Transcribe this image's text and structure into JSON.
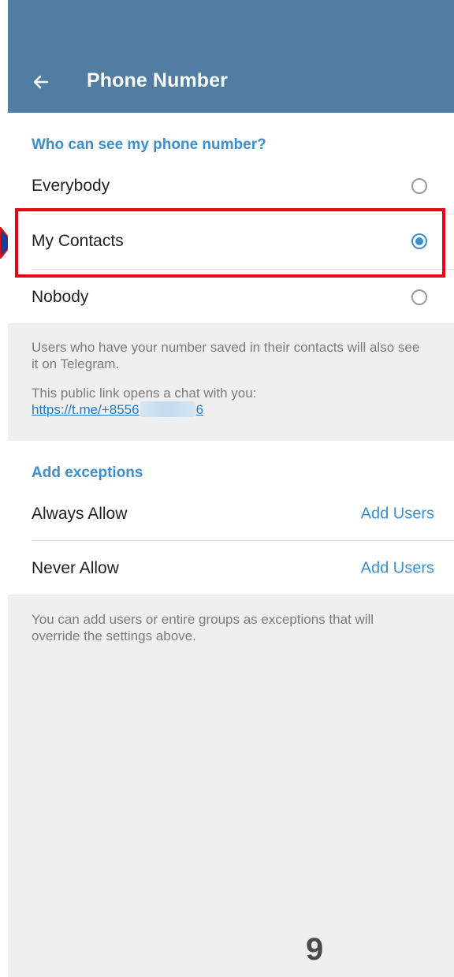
{
  "appbar": {
    "title": "Phone Number",
    "back_icon": "arrow-left-icon",
    "color": "#517da2"
  },
  "privacy": {
    "header": "Who can see my phone number?",
    "options": [
      {
        "label": "Everybody",
        "selected": false
      },
      {
        "label": "My Contacts",
        "selected": true
      },
      {
        "label": "Nobody",
        "selected": false
      }
    ]
  },
  "info": {
    "text1": "Users who have your number saved in their contacts will also see it on Telegram.",
    "text2": "This public link opens a chat with you:",
    "link_prefix": "https://t.me/+8556",
    "link_suffix": "6"
  },
  "exceptions": {
    "header": "Add exceptions",
    "rows": [
      {
        "label": "Always Allow",
        "action": "Add Users"
      },
      {
        "label": "Never Allow",
        "action": "Add Users"
      }
    ],
    "footer": "You can add users or entire groups as exceptions that will override the settings above."
  },
  "annotation": {
    "page_number": "9",
    "highlight_color": "#e30613",
    "arrow_color": "#1b3f95"
  },
  "colors": {
    "accent": "#3a8fd0",
    "background": "#efeff0"
  }
}
